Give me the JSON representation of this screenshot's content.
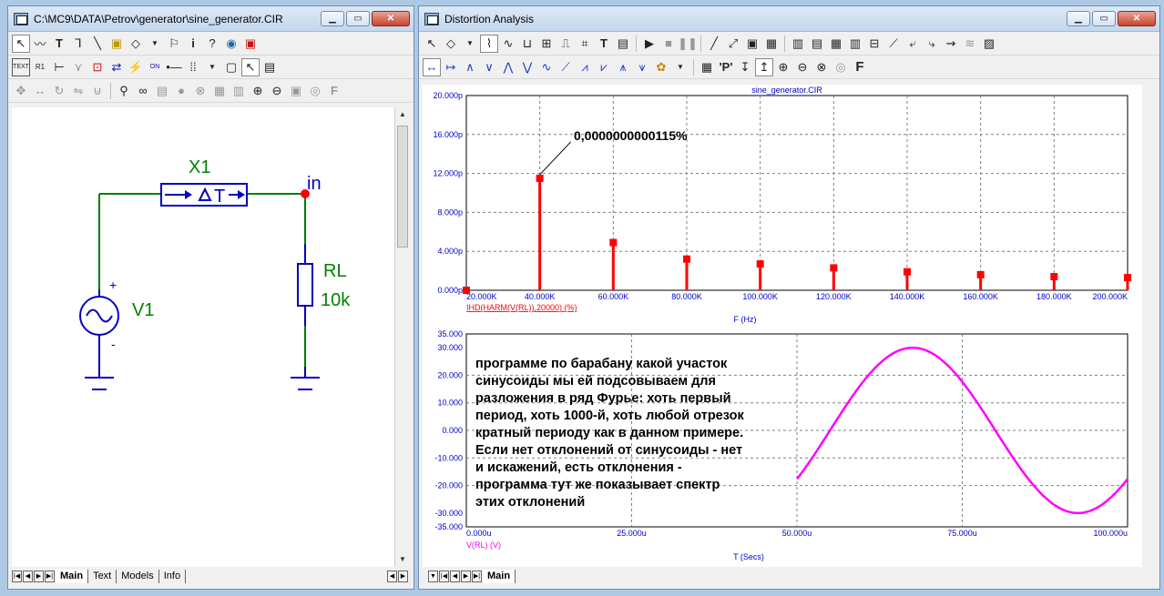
{
  "schematic": {
    "title": "C:\\MC9\\DATA\\Petrov\\generator\\sine_generator.CIR",
    "labels": {
      "x1": "X1",
      "in": "in",
      "rl": "RL",
      "rl_val": "10k",
      "v1": "V1",
      "plus": "+",
      "minus": "-"
    },
    "tabs": [
      "Main",
      "Text",
      "Models",
      "Info"
    ]
  },
  "analysis": {
    "title": "Distortion Analysis",
    "tabs": [
      "Main"
    ],
    "colors": {
      "harm": "#ff0000",
      "wave": "#ff00ff",
      "axis": "#0000c8"
    }
  },
  "chart_data": [
    {
      "type": "bar",
      "title": "sine_generator.CIR",
      "xlabel": "F (Hz)",
      "series_label": "IHD(HARM(V(RL)),20000) (%)",
      "x_ticks": [
        "20.000K",
        "40.000K",
        "60.000K",
        "80.000K",
        "100.000K",
        "120.000K",
        "140.000K",
        "160.000K",
        "180.000K",
        "200.000K"
      ],
      "y_ticks": [
        "0.000p",
        "4.000p",
        "8.000p",
        "12.000p",
        "16.000p",
        "20.000p"
      ],
      "xlim": [
        20000,
        200000
      ],
      "ylim": [
        0,
        20
      ],
      "x": [
        20000,
        40000,
        60000,
        80000,
        100000,
        120000,
        140000,
        160000,
        180000,
        200000
      ],
      "values": [
        0,
        11.5,
        4.9,
        3.2,
        2.7,
        2.3,
        1.9,
        1.6,
        1.4,
        1.3
      ],
      "annotation": "0,0000000000115%"
    },
    {
      "type": "line",
      "xlabel": "T (Secs)",
      "series_label": "V(RL) (V)",
      "x_ticks": [
        "0.000u",
        "25.000u",
        "50.000u",
        "75.000u",
        "100.000u"
      ],
      "y_ticks": [
        "-35.000",
        "-30.000",
        "-20.000",
        "-10.000",
        "0.000",
        "10.000",
        "20.000",
        "30.000",
        "35.000"
      ],
      "xlim": [
        0,
        100
      ],
      "ylim": [
        -35,
        35
      ],
      "wave": {
        "t_start": 50,
        "t_end": 100,
        "amplitude": 30,
        "period": 50,
        "peak_at": 67.5
      }
    }
  ],
  "annotation_text": [
    "программе по барабану какой участок",
    "синусоиды мы ей подсовываем для",
    "разложения в ряд Фурье: хоть первый",
    "период, хоть 1000-й, хоть любой отрезок",
    "кратный периоду как в данном примере.",
    "Если нет отклонений от синусоиды - нет",
    "и искажений, есть отклонения -",
    "программа тут же показывает спектр",
    "этих отклонений"
  ]
}
